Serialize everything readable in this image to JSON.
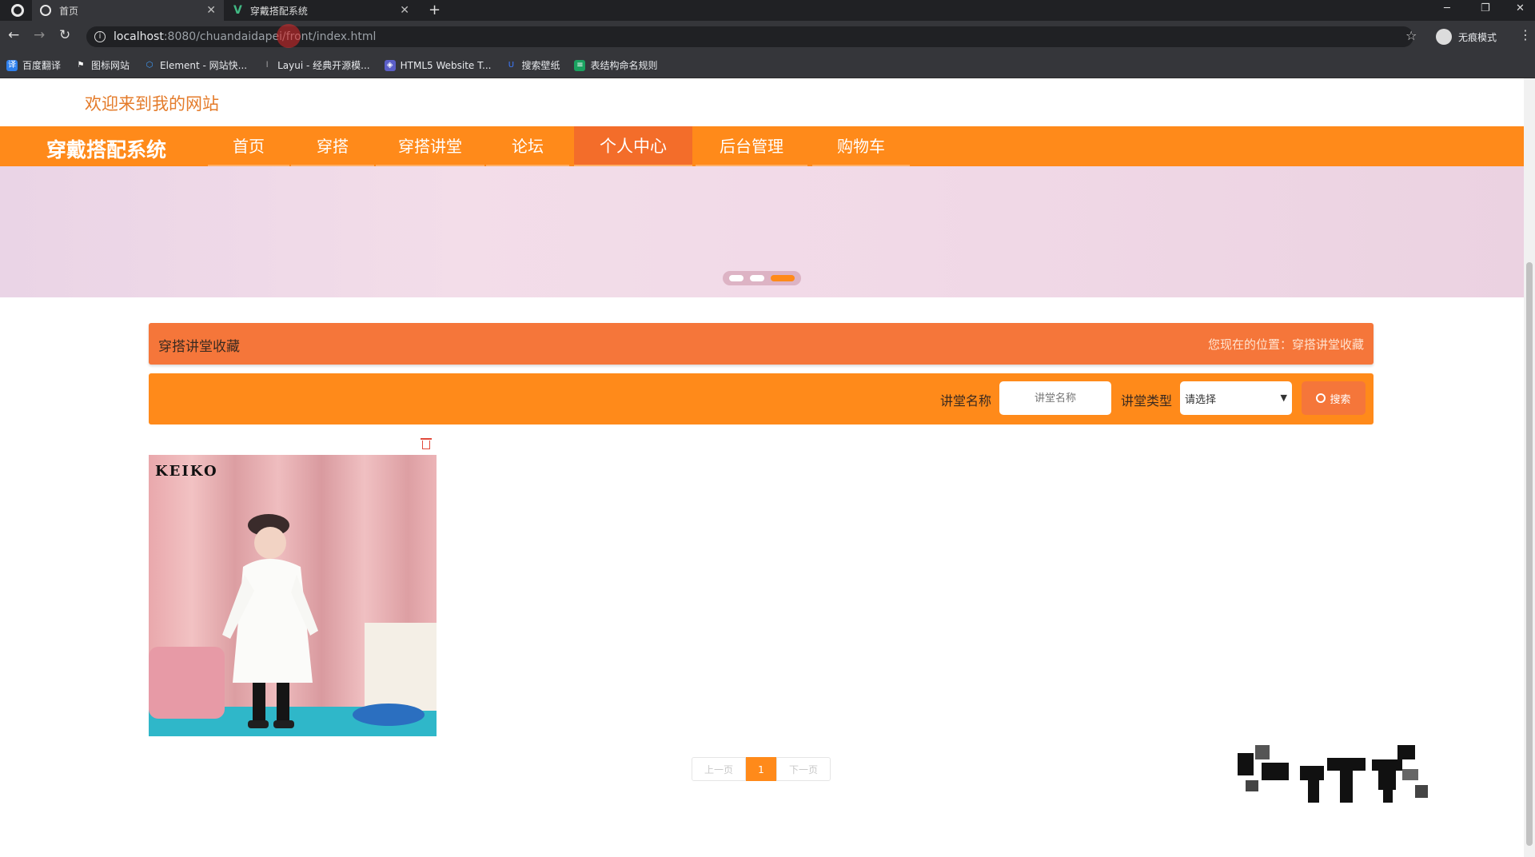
{
  "browser": {
    "tabs": [
      {
        "title": "首页"
      },
      {
        "title": "穿戴搭配系统"
      }
    ],
    "url_host": "localhost",
    "url_path": ":8080/chuandaidapei/front/index.html",
    "profile_label": "无痕模式",
    "bookmarks": [
      {
        "label": "百度翻译",
        "color": "#2f80ed"
      },
      {
        "label": "图标网站",
        "color": "#ffffff"
      },
      {
        "label": "Element - 网站快...",
        "color": "#409eff"
      },
      {
        "label": "Layui - 经典开源模...",
        "color": "#aaaaaa"
      },
      {
        "label": "HTML5 Website T...",
        "color": "#5b5fc7"
      },
      {
        "label": "搜索壁纸",
        "color": "#3d7bff"
      },
      {
        "label": "表结构命名规则",
        "color": "#1aa260"
      }
    ]
  },
  "site": {
    "welcome": "欢迎来到我的网站",
    "logo": "穿戴搭配系统",
    "nav": [
      {
        "label": "首页"
      },
      {
        "label": "穿搭"
      },
      {
        "label": "穿搭讲堂"
      },
      {
        "label": "论坛"
      },
      {
        "label": "个人中心",
        "active": true
      },
      {
        "label": "后台管理"
      },
      {
        "label": "购物车"
      }
    ],
    "banner_slides": 3,
    "banner_active": 3,
    "page_title": "穿搭讲堂收藏",
    "location_text": "您现在的位置：穿搭讲堂收藏",
    "search": {
      "name_label": "讲堂名称",
      "name_placeholder": "讲堂名称",
      "type_label": "讲堂类型",
      "type_selected": "请选择",
      "button_label": "搜索"
    },
    "cards": [
      {
        "brand": "KEIKO"
      }
    ],
    "pager": {
      "prev": "上一页",
      "current": "1",
      "next": "下一页"
    },
    "accent_color": "#ff8a1a",
    "header_bar_color": "#f5763a"
  }
}
